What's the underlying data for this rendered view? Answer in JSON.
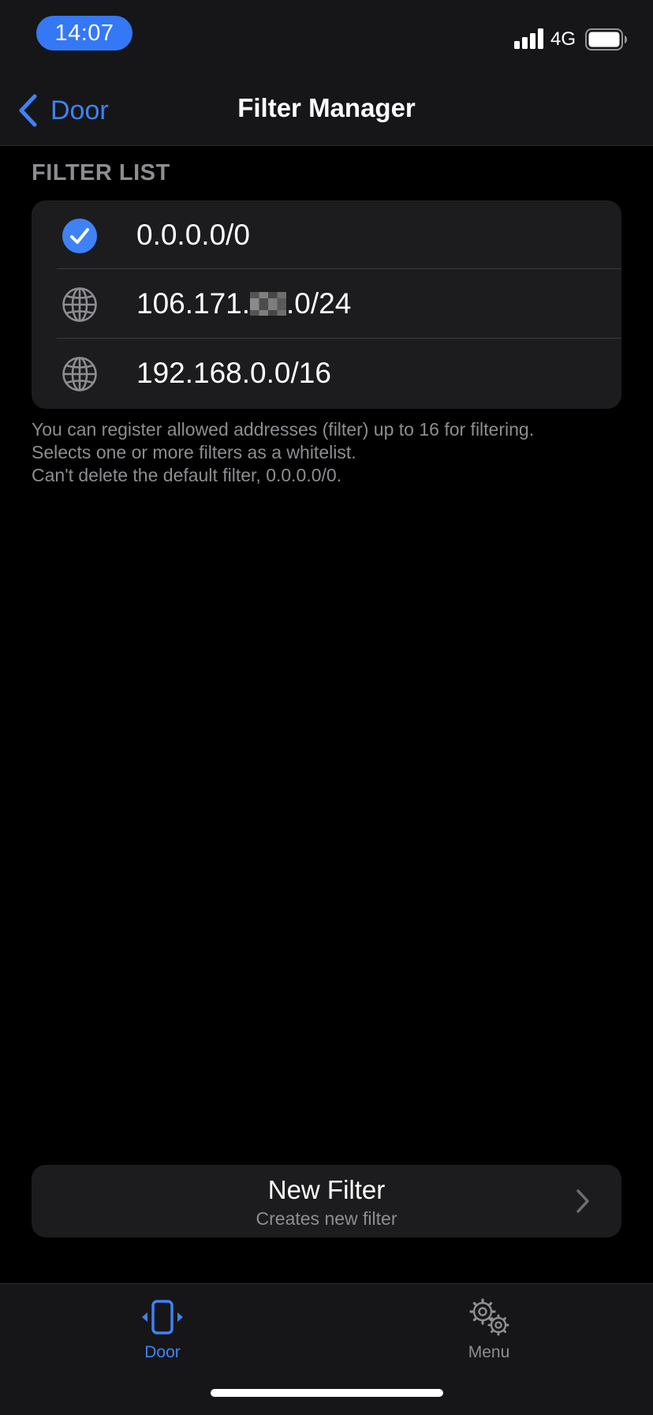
{
  "status_bar": {
    "time": "14:07",
    "network": "4G",
    "accent": "#3478f6"
  },
  "nav": {
    "back_label": "Door",
    "title": "Filter Manager"
  },
  "filters": {
    "header": "FILTER LIST",
    "items": [
      {
        "prefix": "0.0.0.0/0",
        "redacted": false,
        "suffix": "",
        "selected": true,
        "icon": "checkmark-circle-icon"
      },
      {
        "prefix": "106.171.",
        "redacted": true,
        "suffix": ".0/24",
        "selected": false,
        "icon": "globe-icon"
      },
      {
        "prefix": "192.168.0.0/16",
        "redacted": false,
        "suffix": "",
        "selected": false,
        "icon": "globe-icon"
      }
    ],
    "footnote": [
      "You can register allowed addresses (filter) up to 16 for filtering.",
      "Selects one or more filters as a whitelist.",
      "Can't delete the default filter, 0.0.0.0/0."
    ]
  },
  "new_filter": {
    "title": "New Filter",
    "subtitle": "Creates new filter"
  },
  "tabs": [
    {
      "label": "Door",
      "icon": "door-icon",
      "active": true
    },
    {
      "label": "Menu",
      "icon": "gears-icon",
      "active": false
    }
  ],
  "colors": {
    "background": "#000000",
    "surface": "#1c1c1e",
    "bar": "#161618",
    "accent": "#3f82f7",
    "secondary_text": "#8d8d92"
  }
}
